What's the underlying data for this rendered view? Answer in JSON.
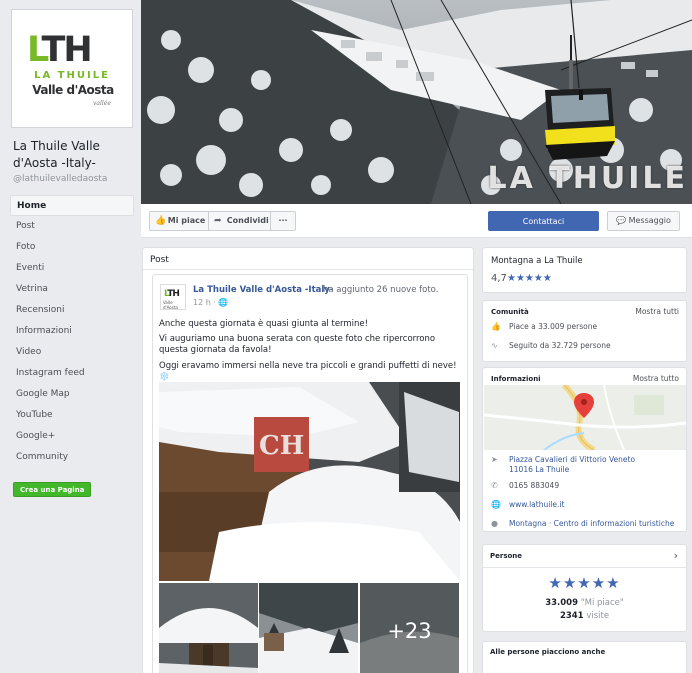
{
  "sidebar": {
    "page_name": "La Thuile Valle d'Aosta -Italy-",
    "handle": "@lathuilevalledaosta",
    "logo": {
      "mark": "LTH",
      "line1": "LA THUILE",
      "line2": "Valle d'Aosta",
      "line3": "vallée"
    },
    "items": [
      {
        "label": "Home"
      },
      {
        "label": "Post"
      },
      {
        "label": "Foto"
      },
      {
        "label": "Eventi"
      },
      {
        "label": "Vetrina"
      },
      {
        "label": "Recensioni"
      },
      {
        "label": "Informazioni"
      },
      {
        "label": "Video"
      },
      {
        "label": "Instagram feed"
      },
      {
        "label": "Google Map"
      },
      {
        "label": "YouTube"
      },
      {
        "label": "Google+"
      },
      {
        "label": "Community"
      }
    ],
    "create_page": "Crea una Pagina"
  },
  "cover": {
    "title": "LA THUILE"
  },
  "actions": {
    "like": "Mi piace",
    "share": "Condividi",
    "more": "···",
    "contact": "Contattaci",
    "message": "Messaggio"
  },
  "feed": {
    "heading": "Post",
    "post": {
      "author": "La Thuile Valle d'Aosta -Italy-",
      "action": "ha aggiunto 26 nuove foto.",
      "time": "12 h · ",
      "text1": "Anche questa giornata è quasi giunta al termine!",
      "text2": "Vi auguriamo una buona serata con queste foto che ripercorrono questa giornata da favola!",
      "text3": "Oggi eravamo immersi nella neve tra piccoli e grandi puffetti di neve! ❄️",
      "more_photos": "+23"
    }
  },
  "about": {
    "title": "Montagna a La Thuile",
    "rating": "4,7",
    "stars": "★★★★★"
  },
  "community": {
    "heading": "Comunità",
    "link": "Mostra tutti",
    "likes": "Piace a 33.009 persone",
    "follows": "Seguito da 32.729 persone"
  },
  "info": {
    "heading": "Informazioni",
    "link": "Mostra tutto",
    "address1": "Piazza Cavalieri di Vittorio Veneto",
    "address2": "11016 La Thuile",
    "phone": "0165 883049",
    "website": "www.lathuile.it",
    "category": "Montagna · Centro di informazioni turistiche"
  },
  "people": {
    "heading": "Persone",
    "stars": "★★★★★",
    "likes_count": "33.009",
    "likes_label": "\"Mi piace\"",
    "visits_count": "2341",
    "visits_label": "visite"
  },
  "also_liked": {
    "heading": "Alle persone piacciono anche"
  },
  "colors": {
    "brand_green": "#78b928",
    "facebook_blue": "#4267b2",
    "link_blue": "#365899",
    "create_green": "#42b72a"
  }
}
